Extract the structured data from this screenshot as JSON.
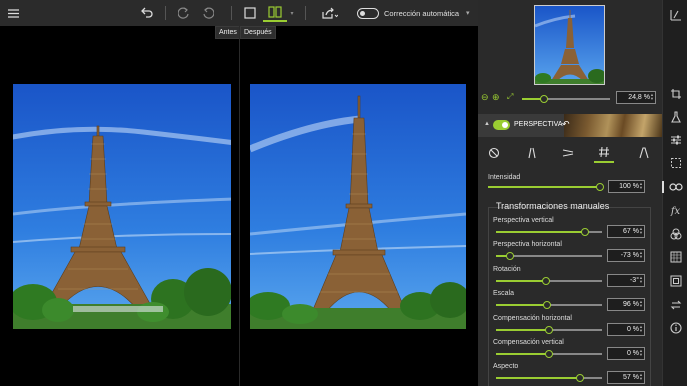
{
  "toolbar": {
    "auto_correction_label": "Corrección automática",
    "tooltip_before": "Antes",
    "tooltip_after": "Después"
  },
  "zoom": {
    "value": "24,8 %",
    "level": 0.25
  },
  "perspective": {
    "label": "PERSPECTIVA",
    "enabled": true
  },
  "tabs": [
    {
      "icon": "circle-slash-icon"
    },
    {
      "icon": "vertical-perspective-icon"
    },
    {
      "icon": "horizontal-perspective-icon"
    },
    {
      "icon": "grid-hash-icon",
      "active": true
    },
    {
      "icon": "trapezoid-icon"
    }
  ],
  "intensity": {
    "label": "Intensidad",
    "value": "100 %",
    "level": 1.0
  },
  "manual": {
    "title": "Transformaciones manuales",
    "params": [
      {
        "label": "Perspectiva vertical",
        "value": "67 %",
        "level": 0.835
      },
      {
        "label": "Perspectiva horizontal",
        "value": "-73 %",
        "level": 0.135
      },
      {
        "label": "Rotación",
        "value": "-3°",
        "level": 0.47
      },
      {
        "label": "Escala",
        "value": "96 %",
        "level": 0.48
      },
      {
        "label": "Compensación horizontal",
        "value": "0 %",
        "level": 0.5
      },
      {
        "label": "Compensación vertical",
        "value": "0 %",
        "level": 0.5
      },
      {
        "label": "Aspecto",
        "value": "57 %",
        "level": 0.79
      }
    ]
  },
  "colors": {
    "accent": "#9acd32",
    "panel": "#2a2a2a",
    "toolbar": "#2b2b2b"
  }
}
